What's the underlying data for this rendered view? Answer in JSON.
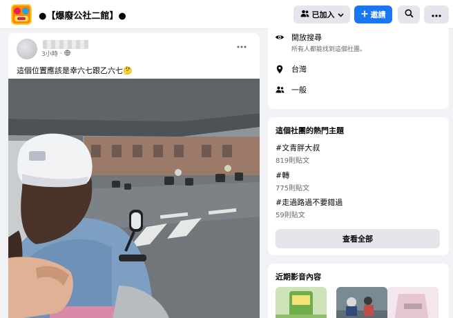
{
  "header": {
    "group_title": "●【爆廢公社二館】●",
    "joined_label": "已加入",
    "invite_label": "邀請"
  },
  "post": {
    "time": "3小時",
    "text": "這個位置應該是幸六七跟乙六七🤔"
  },
  "about": {
    "visibility_title": "開放搜尋",
    "visibility_desc": "所有人都能找到這個社團。",
    "location": "台灣",
    "type": "一般"
  },
  "topics": {
    "title": "這個社團的熱門主題",
    "items": [
      {
        "name": "#文青胖大叔",
        "count": "819則貼文"
      },
      {
        "name": "#轉",
        "count": "775則貼文"
      },
      {
        "name": "#走過路過不要錯過",
        "count": "59則貼文"
      }
    ],
    "see_all_label": "查看全部"
  },
  "media": {
    "title": "近期影音內容"
  },
  "colors": {
    "accent": "#1877f2",
    "background": "#f0f2f5",
    "card": "#ffffff",
    "secondary_text": "#65676b"
  },
  "icons": [
    "people-icon",
    "plus-icon",
    "search-icon",
    "more-icon",
    "globe-icon",
    "eye-icon",
    "location-pin-icon"
  ]
}
